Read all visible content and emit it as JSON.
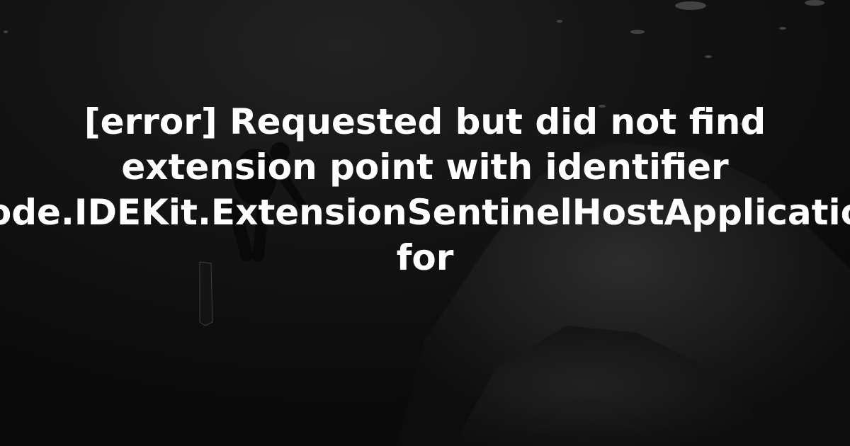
{
  "title_lines": [
    "[error] Requested but did not find",
    "extension point with identifier",
    "Xcode.IDEKit.ExtensionSentinelHostApplications",
    "for"
  ]
}
